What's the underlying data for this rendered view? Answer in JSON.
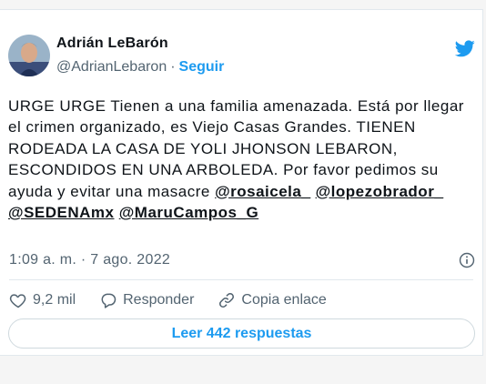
{
  "user": {
    "name": "Adrián LeBarón",
    "handle": "@AdrianLebaron",
    "separator": "·",
    "follow_label": "Seguir"
  },
  "tweet": {
    "text_before": "URGE URGE Tienen a una familia amenazada. Está por llegar el crimen organizado, es Viejo Casas Grandes. TIENEN RODEADA LA CASA DE YOLI JHONSON LEBARON, ESCONDIDOS EN UNA ARBOLEDA. Por favor pedimos su ayuda y evitar una masacre ",
    "mentions": [
      "@rosaicela_",
      "@lopezobrador_",
      "@SEDENAmx",
      "@MaruCampos_G"
    ]
  },
  "timestamp": "1:09 a. m. · 7 ago. 2022",
  "actions": {
    "like_count": "9,2 mil",
    "reply_label": "Responder",
    "copy_link_label": "Copia enlace"
  },
  "read_replies_label": "Leer 442 respuestas",
  "colors": {
    "accent": "#1d9bf0",
    "text": "#0f1419",
    "muted": "#536471",
    "border": "#e1e8ed"
  },
  "icons": [
    "twitter-bird-icon",
    "info-icon",
    "heart-icon",
    "reply-icon",
    "link-icon"
  ]
}
